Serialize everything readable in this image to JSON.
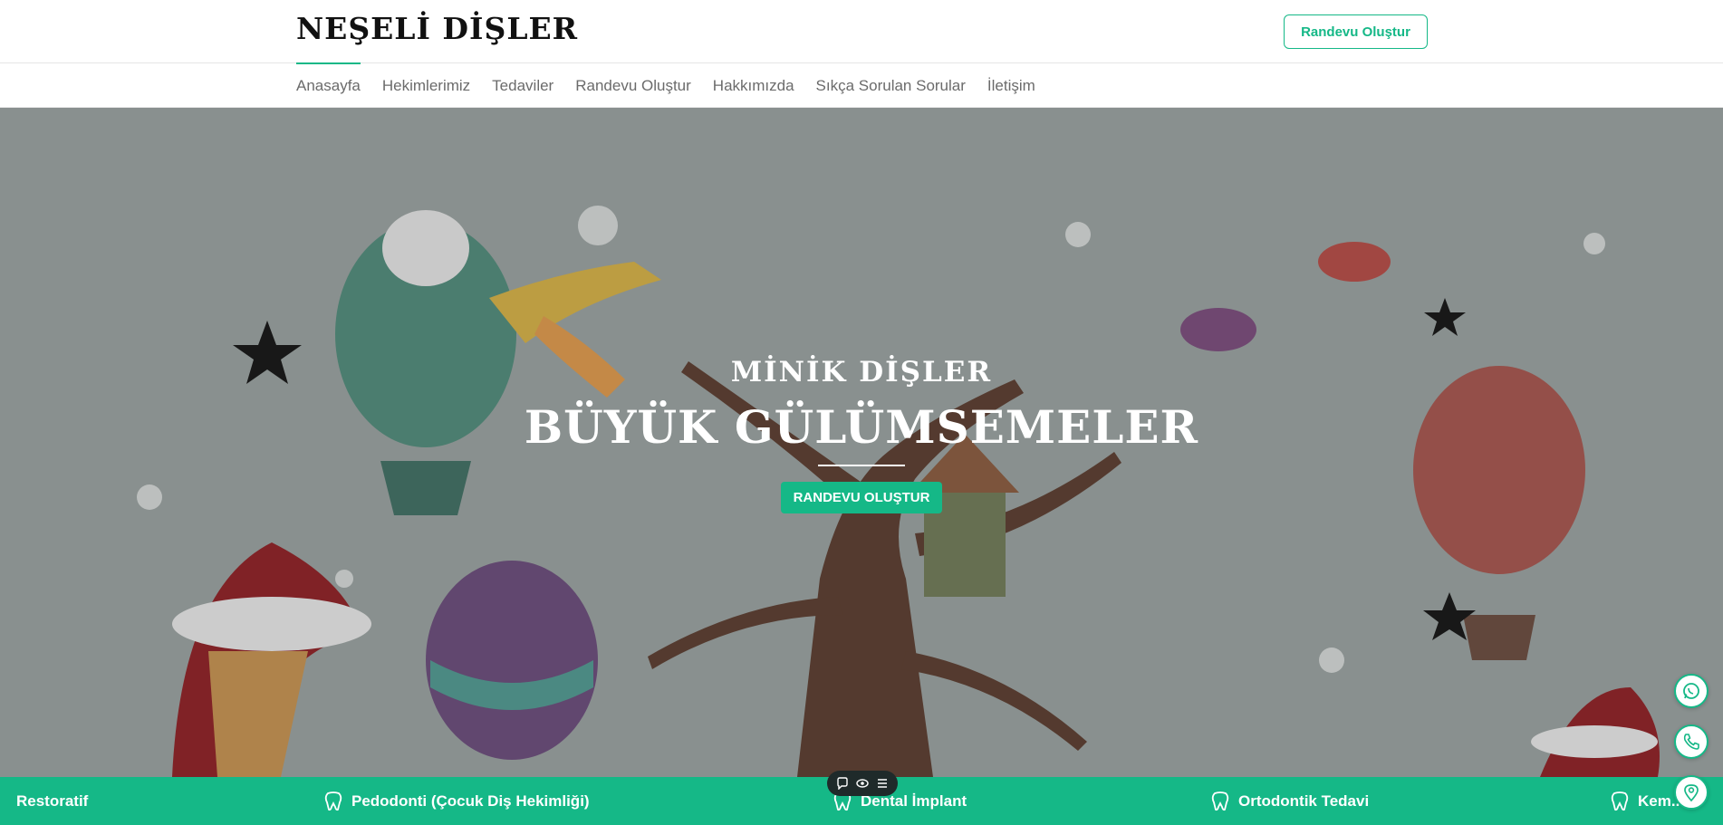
{
  "header": {
    "brand": "NEŞELİ DİŞLER",
    "cta_label": "Randevu Oluştur"
  },
  "nav": {
    "items": [
      {
        "label": "Anasayfa"
      },
      {
        "label": "Hekimlerimiz"
      },
      {
        "label": "Tedaviler"
      },
      {
        "label": "Randevu Oluştur"
      },
      {
        "label": "Hakkımızda"
      },
      {
        "label": "Sıkça Sorulan Sorular"
      },
      {
        "label": "İletişim"
      }
    ]
  },
  "hero": {
    "subtitle": "MİNİK DİŞLER",
    "title": "BÜYÜK GÜLÜMSEMELER",
    "button_label": "RANDEVU OLUŞTUR"
  },
  "ticker": {
    "items": [
      {
        "label": "Restoratif"
      },
      {
        "label": "Pedodonti (Çocuk Diş Hekimliği)"
      },
      {
        "label": "Dental İmplant"
      },
      {
        "label": "Ortodontik Tedavi"
      },
      {
        "label": "Kem..."
      }
    ]
  },
  "floating": {
    "icons": [
      "whatsapp-icon",
      "phone-icon",
      "location-icon"
    ]
  },
  "colors": {
    "accent": "#15b887",
    "text_dark": "#111111",
    "nav_text": "#6b6b6b"
  }
}
